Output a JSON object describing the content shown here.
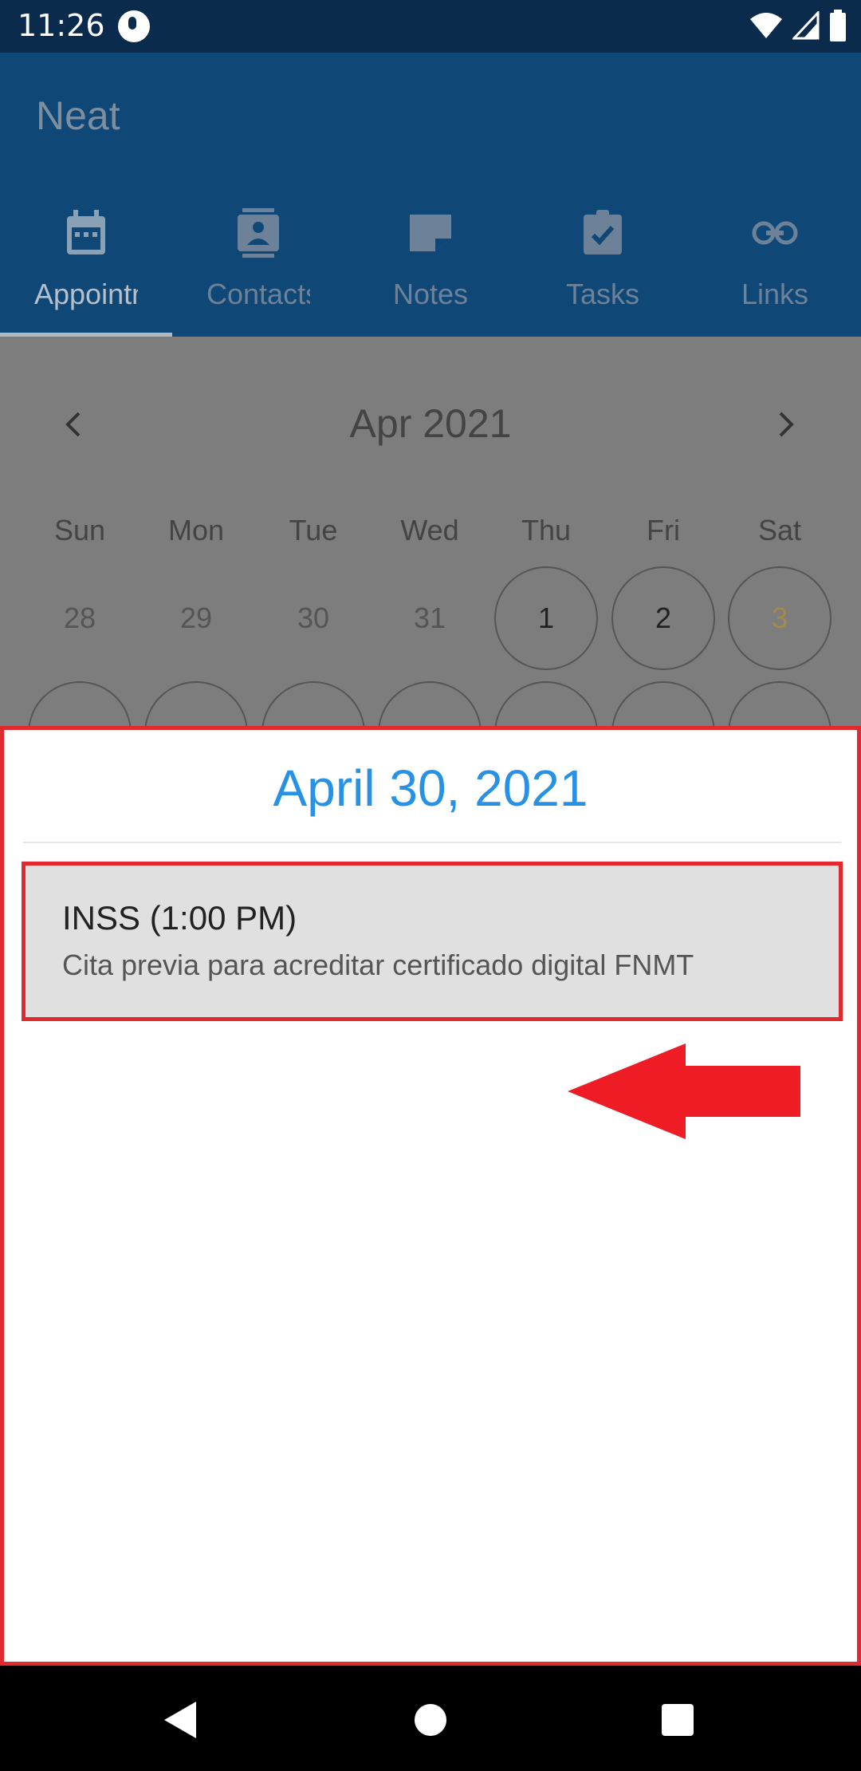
{
  "status_bar": {
    "time": "11:26",
    "icons": [
      "app-notification-icon",
      "wifi-icon",
      "signal-icon",
      "battery-icon"
    ]
  },
  "app": {
    "title": "Neat",
    "tabs": [
      {
        "label": "Appointments",
        "icon": "calendar-icon",
        "active": true
      },
      {
        "label": "Contacts",
        "icon": "contact-card-icon",
        "active": false
      },
      {
        "label": "Notes",
        "icon": "note-icon",
        "active": false
      },
      {
        "label": "Tasks",
        "icon": "task-clipboard-icon",
        "active": false
      },
      {
        "label": "Links",
        "icon": "link-icon",
        "active": false
      }
    ]
  },
  "calendar": {
    "month_label": "Apr 2021",
    "weekdays": [
      "Sun",
      "Mon",
      "Tue",
      "Wed",
      "Thu",
      "Fri",
      "Sat"
    ],
    "first_row_days": [
      "28",
      "29",
      "30",
      "31",
      "1",
      "2",
      "3"
    ]
  },
  "sheet": {
    "date_heading": "April 30, 2021",
    "events": [
      {
        "title": "INSS (1:00 PM)",
        "description": "Cita previa para acreditar certificado digital FNMT"
      }
    ]
  },
  "colors": {
    "app_bar": "#0f4777",
    "status_bar": "#0a2b4b",
    "date_heading": "#2792e5",
    "highlight_red": "#e02a2f"
  }
}
